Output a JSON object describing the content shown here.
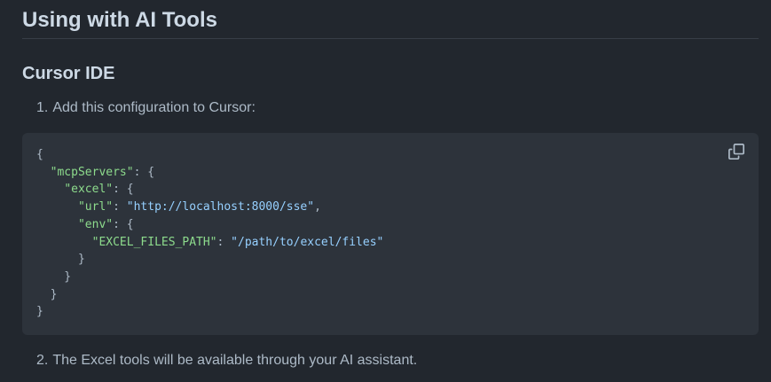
{
  "heading": "Using with AI Tools",
  "subheading": "Cursor IDE",
  "steps": [
    {
      "number": "1.",
      "text": "Add this configuration to Cursor:"
    },
    {
      "number": "2.",
      "text": "The Excel tools will be available through your AI assistant."
    }
  ],
  "code": {
    "lines": [
      [
        {
          "t": "{",
          "c": "p"
        }
      ],
      [
        {
          "t": "  ",
          "c": "p"
        },
        {
          "t": "\"mcpServers\"",
          "c": "key"
        },
        {
          "t": ": {",
          "c": "p"
        }
      ],
      [
        {
          "t": "    ",
          "c": "p"
        },
        {
          "t": "\"excel\"",
          "c": "key"
        },
        {
          "t": ": {",
          "c": "p"
        }
      ],
      [
        {
          "t": "      ",
          "c": "p"
        },
        {
          "t": "\"url\"",
          "c": "key"
        },
        {
          "t": ": ",
          "c": "p"
        },
        {
          "t": "\"http://localhost:8000/sse\"",
          "c": "str"
        },
        {
          "t": ",",
          "c": "p"
        }
      ],
      [
        {
          "t": "      ",
          "c": "p"
        },
        {
          "t": "\"env\"",
          "c": "key"
        },
        {
          "t": ": {",
          "c": "p"
        }
      ],
      [
        {
          "t": "        ",
          "c": "p"
        },
        {
          "t": "\"EXCEL_FILES_PATH\"",
          "c": "key"
        },
        {
          "t": ": ",
          "c": "p"
        },
        {
          "t": "\"/path/to/excel/files\"",
          "c": "str"
        }
      ],
      [
        {
          "t": "      }",
          "c": "p"
        }
      ],
      [
        {
          "t": "    }",
          "c": "p"
        }
      ],
      [
        {
          "t": "  }",
          "c": "p"
        }
      ],
      [
        {
          "t": "}",
          "c": "p"
        }
      ]
    ]
  },
  "copy_button": {
    "icon": "copy-icon"
  },
  "colors": {
    "background": "#22272e",
    "code_background": "#2d333b",
    "heading_text": "#cdd9e5",
    "body_text": "#adbac7",
    "json_key": "#8ddb8c",
    "json_string": "#96d0ff"
  }
}
